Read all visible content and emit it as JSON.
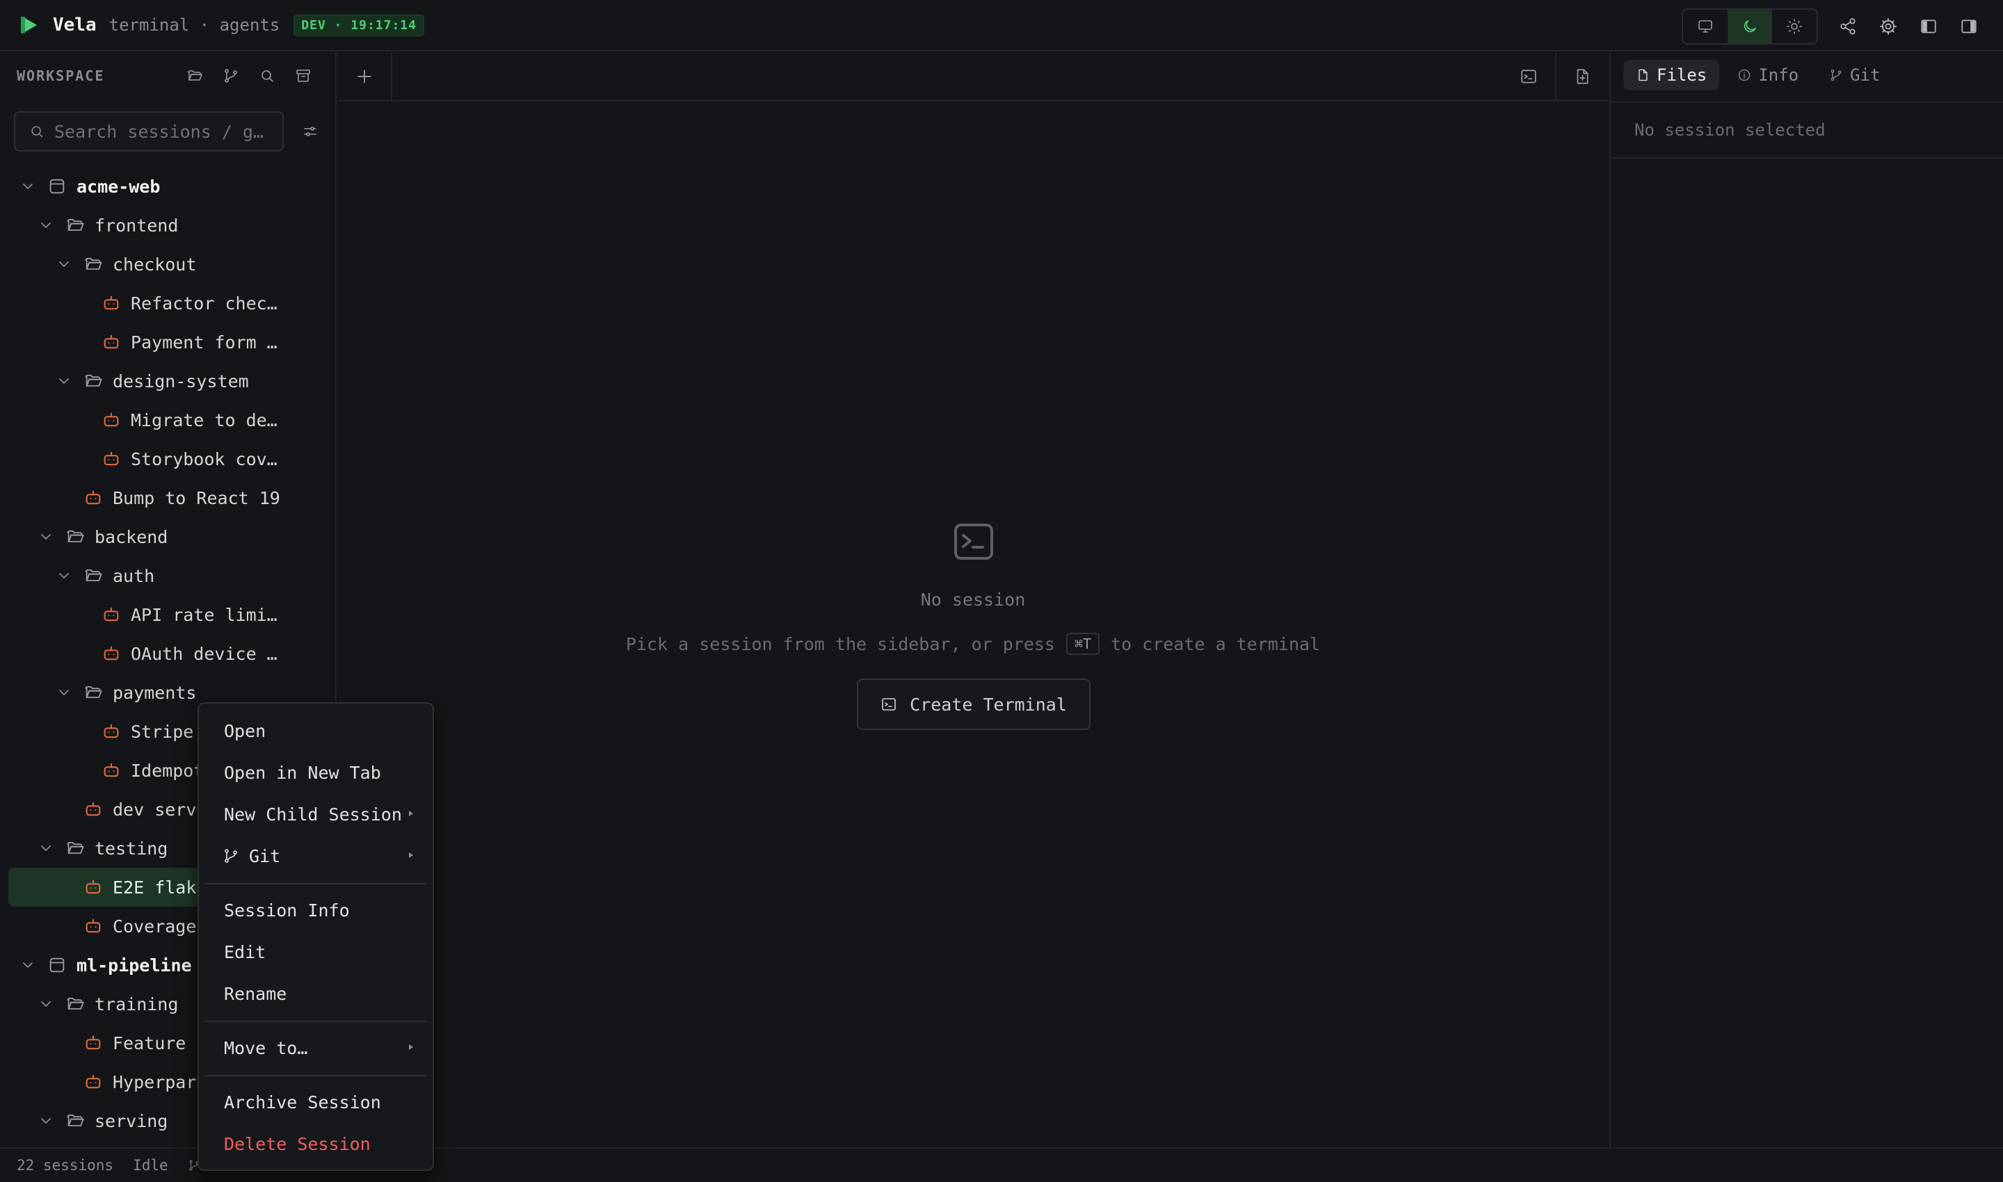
{
  "topbar": {
    "app_name": "Vela",
    "subtitle": "terminal · agents",
    "badge": "DEV · 19:17:14",
    "theme_buttons": [
      "monitor-icon",
      "moon-icon",
      "sun-icon"
    ],
    "active_theme": "moon-icon",
    "right_icons": [
      "share-icon",
      "settings-icon",
      "left-panel-icon",
      "right-panel-icon"
    ]
  },
  "sidebar": {
    "title": "WORKSPACE",
    "search_placeholder": "Search sessions / g…",
    "tree": [
      {
        "label": "acme-web",
        "kind": "project",
        "depth": 0,
        "expanded": true
      },
      {
        "label": "frontend",
        "kind": "folder",
        "depth": 1,
        "expanded": true
      },
      {
        "label": "checkout",
        "kind": "folder",
        "depth": 2,
        "expanded": true
      },
      {
        "label": "Refactor chec…",
        "kind": "agent",
        "depth": 3
      },
      {
        "label": "Payment form …",
        "kind": "agent",
        "depth": 3
      },
      {
        "label": "design-system",
        "kind": "folder",
        "depth": 2,
        "expanded": true
      },
      {
        "label": "Migrate to de…",
        "kind": "agent",
        "depth": 3
      },
      {
        "label": "Storybook cov…",
        "kind": "agent",
        "depth": 3
      },
      {
        "label": "Bump to React 19",
        "kind": "agent",
        "depth": 2
      },
      {
        "label": "backend",
        "kind": "folder",
        "depth": 1,
        "expanded": true
      },
      {
        "label": "auth",
        "kind": "folder",
        "depth": 2,
        "expanded": true
      },
      {
        "label": "API rate limi…",
        "kind": "agent",
        "depth": 3
      },
      {
        "label": "OAuth device …",
        "kind": "agent",
        "depth": 3
      },
      {
        "label": "payments",
        "kind": "folder",
        "depth": 2,
        "expanded": true
      },
      {
        "label": "Stripe",
        "kind": "agent",
        "depth": 3
      },
      {
        "label": "Idempot",
        "kind": "agent",
        "depth": 3
      },
      {
        "label": "dev serve",
        "kind": "agent",
        "depth": 2
      },
      {
        "label": "testing",
        "kind": "folder",
        "depth": 1,
        "expanded": true
      },
      {
        "label": "E2E flake",
        "kind": "agent",
        "depth": 2,
        "selected": true
      },
      {
        "label": "Coverage",
        "kind": "agent",
        "depth": 2
      },
      {
        "label": "ml-pipeline",
        "kind": "project",
        "depth": 0,
        "expanded": true
      },
      {
        "label": "training",
        "kind": "folder",
        "depth": 1,
        "expanded": true
      },
      {
        "label": "Feature",
        "kind": "agent",
        "depth": 2
      },
      {
        "label": "Hyperpara",
        "kind": "agent",
        "depth": 2
      },
      {
        "label": "serving",
        "kind": "folder",
        "depth": 1,
        "expanded": true
      }
    ]
  },
  "center": {
    "empty_title": "No session",
    "hint_before": "Pick a session from the sidebar, or press",
    "hint_kbd": "⌘T",
    "hint_after": "to create a terminal",
    "create_button": "Create Terminal"
  },
  "right_panel": {
    "tabs": [
      {
        "label": "Files",
        "icon": "file-icon",
        "active": true
      },
      {
        "label": "Info",
        "icon": "info-icon",
        "active": false
      },
      {
        "label": "Git",
        "icon": "git-branch-icon",
        "active": false
      }
    ],
    "empty_text": "No session selected"
  },
  "statusbar": {
    "sessions": "22 sessions",
    "state": "Idle"
  },
  "context_menu": {
    "items": [
      {
        "label": "Open"
      },
      {
        "label": "Open in New Tab"
      },
      {
        "label": "New Child Session",
        "submenu": true
      },
      {
        "label": "Git",
        "submenu": true,
        "icon": "git-branch-icon"
      },
      {
        "label": "Session Info"
      },
      {
        "label": "Edit"
      },
      {
        "label": "Rename"
      },
      {
        "label": "Move to…",
        "submenu": true
      },
      {
        "label": "Archive Session"
      },
      {
        "label": "Delete Session",
        "danger": true
      }
    ]
  },
  "colors": {
    "background": "#141518",
    "accent_green": "#4fcf7a",
    "agent_orange": "#e2683d",
    "danger_red": "#f0605a",
    "selected_row": "#1c3526"
  }
}
